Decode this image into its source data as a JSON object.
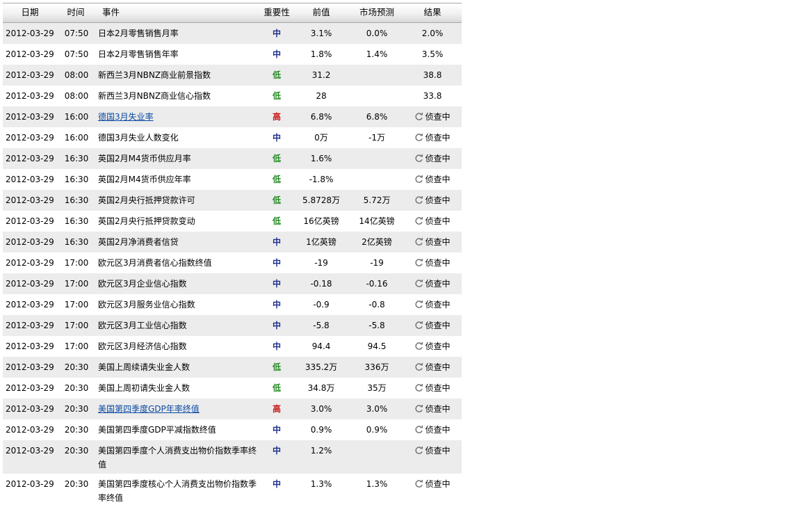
{
  "headers": {
    "date": "日期",
    "time": "时间",
    "event": "事件",
    "importance": "重要性",
    "previous": "前值",
    "forecast": "市场预测",
    "actual": "结果"
  },
  "colors": {
    "importance_mid": "#1c2d8f",
    "importance_low": "#1f8a1f",
    "importance_high": "#c81414",
    "link": "#0b4aa2",
    "alt_row": "#ececec"
  },
  "icons": {
    "pending_status": "refresh-icon"
  },
  "rows": [
    {
      "date": "2012-03-29",
      "time": "07:50",
      "event": "日本2月零售销售月率",
      "importance": "中",
      "level": "mid",
      "previous": "3.1%",
      "forecast": "0.0%",
      "actual": "2.0%",
      "pending": false,
      "link": false
    },
    {
      "date": "2012-03-29",
      "time": "07:50",
      "event": "日本2月零售销售年率",
      "importance": "中",
      "level": "mid",
      "previous": "1.8%",
      "forecast": "1.4%",
      "actual": "3.5%",
      "pending": false,
      "link": false
    },
    {
      "date": "2012-03-29",
      "time": "08:00",
      "event": "新西兰3月NBNZ商业前景指数",
      "importance": "低",
      "level": "low",
      "previous": "31.2",
      "forecast": "",
      "actual": "38.8",
      "pending": false,
      "link": false
    },
    {
      "date": "2012-03-29",
      "time": "08:00",
      "event": "新西兰3月NBNZ商业信心指数",
      "importance": "低",
      "level": "low",
      "previous": "28",
      "forecast": "",
      "actual": "33.8",
      "pending": false,
      "link": false
    },
    {
      "date": "2012-03-29",
      "time": "16:00",
      "event": "德国3月失业率",
      "importance": "高",
      "level": "high",
      "previous": "6.8%",
      "forecast": "6.8%",
      "actual": "侦查中",
      "pending": true,
      "link": true
    },
    {
      "date": "2012-03-29",
      "time": "16:00",
      "event": "德国3月失业人数变化",
      "importance": "中",
      "level": "mid",
      "previous": "0万",
      "forecast": "-1万",
      "actual": "侦查中",
      "pending": true,
      "link": false
    },
    {
      "date": "2012-03-29",
      "time": "16:30",
      "event": "英国2月M4货币供应月率",
      "importance": "低",
      "level": "low",
      "previous": "1.6%",
      "forecast": "",
      "actual": "侦查中",
      "pending": true,
      "link": false
    },
    {
      "date": "2012-03-29",
      "time": "16:30",
      "event": "英国2月M4货币供应年率",
      "importance": "低",
      "level": "low",
      "previous": "-1.8%",
      "forecast": "",
      "actual": "侦查中",
      "pending": true,
      "link": false
    },
    {
      "date": "2012-03-29",
      "time": "16:30",
      "event": "英国2月央行抵押贷款许可",
      "importance": "低",
      "level": "low",
      "previous": "5.8728万",
      "forecast": "5.72万",
      "actual": "侦查中",
      "pending": true,
      "link": false
    },
    {
      "date": "2012-03-29",
      "time": "16:30",
      "event": "英国2月央行抵押贷款变动",
      "importance": "低",
      "level": "low",
      "previous": "16亿英镑",
      "forecast": "14亿英镑",
      "actual": "侦查中",
      "pending": true,
      "link": false
    },
    {
      "date": "2012-03-29",
      "time": "16:30",
      "event": "英国2月净消费者信贷",
      "importance": "中",
      "level": "mid",
      "previous": "1亿英镑",
      "forecast": "2亿英镑",
      "actual": "侦查中",
      "pending": true,
      "link": false
    },
    {
      "date": "2012-03-29",
      "time": "17:00",
      "event": "欧元区3月消费者信心指数终值",
      "importance": "中",
      "level": "mid",
      "previous": "-19",
      "forecast": "-19",
      "actual": "侦查中",
      "pending": true,
      "link": false
    },
    {
      "date": "2012-03-29",
      "time": "17:00",
      "event": "欧元区3月企业信心指数",
      "importance": "中",
      "level": "mid",
      "previous": "-0.18",
      "forecast": "-0.16",
      "actual": "侦查中",
      "pending": true,
      "link": false
    },
    {
      "date": "2012-03-29",
      "time": "17:00",
      "event": "欧元区3月服务业信心指数",
      "importance": "中",
      "level": "mid",
      "previous": "-0.9",
      "forecast": "-0.8",
      "actual": "侦查中",
      "pending": true,
      "link": false
    },
    {
      "date": "2012-03-29",
      "time": "17:00",
      "event": "欧元区3月工业信心指数",
      "importance": "中",
      "level": "mid",
      "previous": "-5.8",
      "forecast": "-5.8",
      "actual": "侦查中",
      "pending": true,
      "link": false
    },
    {
      "date": "2012-03-29",
      "time": "17:00",
      "event": "欧元区3月经济信心指数",
      "importance": "中",
      "level": "mid",
      "previous": "94.4",
      "forecast": "94.5",
      "actual": "侦查中",
      "pending": true,
      "link": false
    },
    {
      "date": "2012-03-29",
      "time": "20:30",
      "event": "美国上周续请失业金人数",
      "importance": "低",
      "level": "low",
      "previous": "335.2万",
      "forecast": "336万",
      "actual": "侦查中",
      "pending": true,
      "link": false
    },
    {
      "date": "2012-03-29",
      "time": "20:30",
      "event": "美国上周初请失业金人数",
      "importance": "低",
      "level": "low",
      "previous": "34.8万",
      "forecast": "35万",
      "actual": "侦查中",
      "pending": true,
      "link": false
    },
    {
      "date": "2012-03-29",
      "time": "20:30",
      "event": "美国第四季度GDP年率终值",
      "importance": "高",
      "level": "high",
      "previous": "3.0%",
      "forecast": "3.0%",
      "actual": "侦查中",
      "pending": true,
      "link": true
    },
    {
      "date": "2012-03-29",
      "time": "20:30",
      "event": "美国第四季度GDP平减指数终值",
      "importance": "中",
      "level": "mid",
      "previous": "0.9%",
      "forecast": "0.9%",
      "actual": "侦查中",
      "pending": true,
      "link": false
    },
    {
      "date": "2012-03-29",
      "time": "20:30",
      "event": "美国第四季度个人消费支出物价指数季率终值",
      "importance": "中",
      "level": "mid",
      "previous": "1.2%",
      "forecast": "",
      "actual": "侦查中",
      "pending": true,
      "link": false
    },
    {
      "date": "2012-03-29",
      "time": "20:30",
      "event": "美国第四季度核心个人消费支出物价指数季率终值",
      "importance": "中",
      "level": "mid",
      "previous": "1.3%",
      "forecast": "1.3%",
      "actual": "侦查中",
      "pending": true,
      "link": false
    }
  ]
}
